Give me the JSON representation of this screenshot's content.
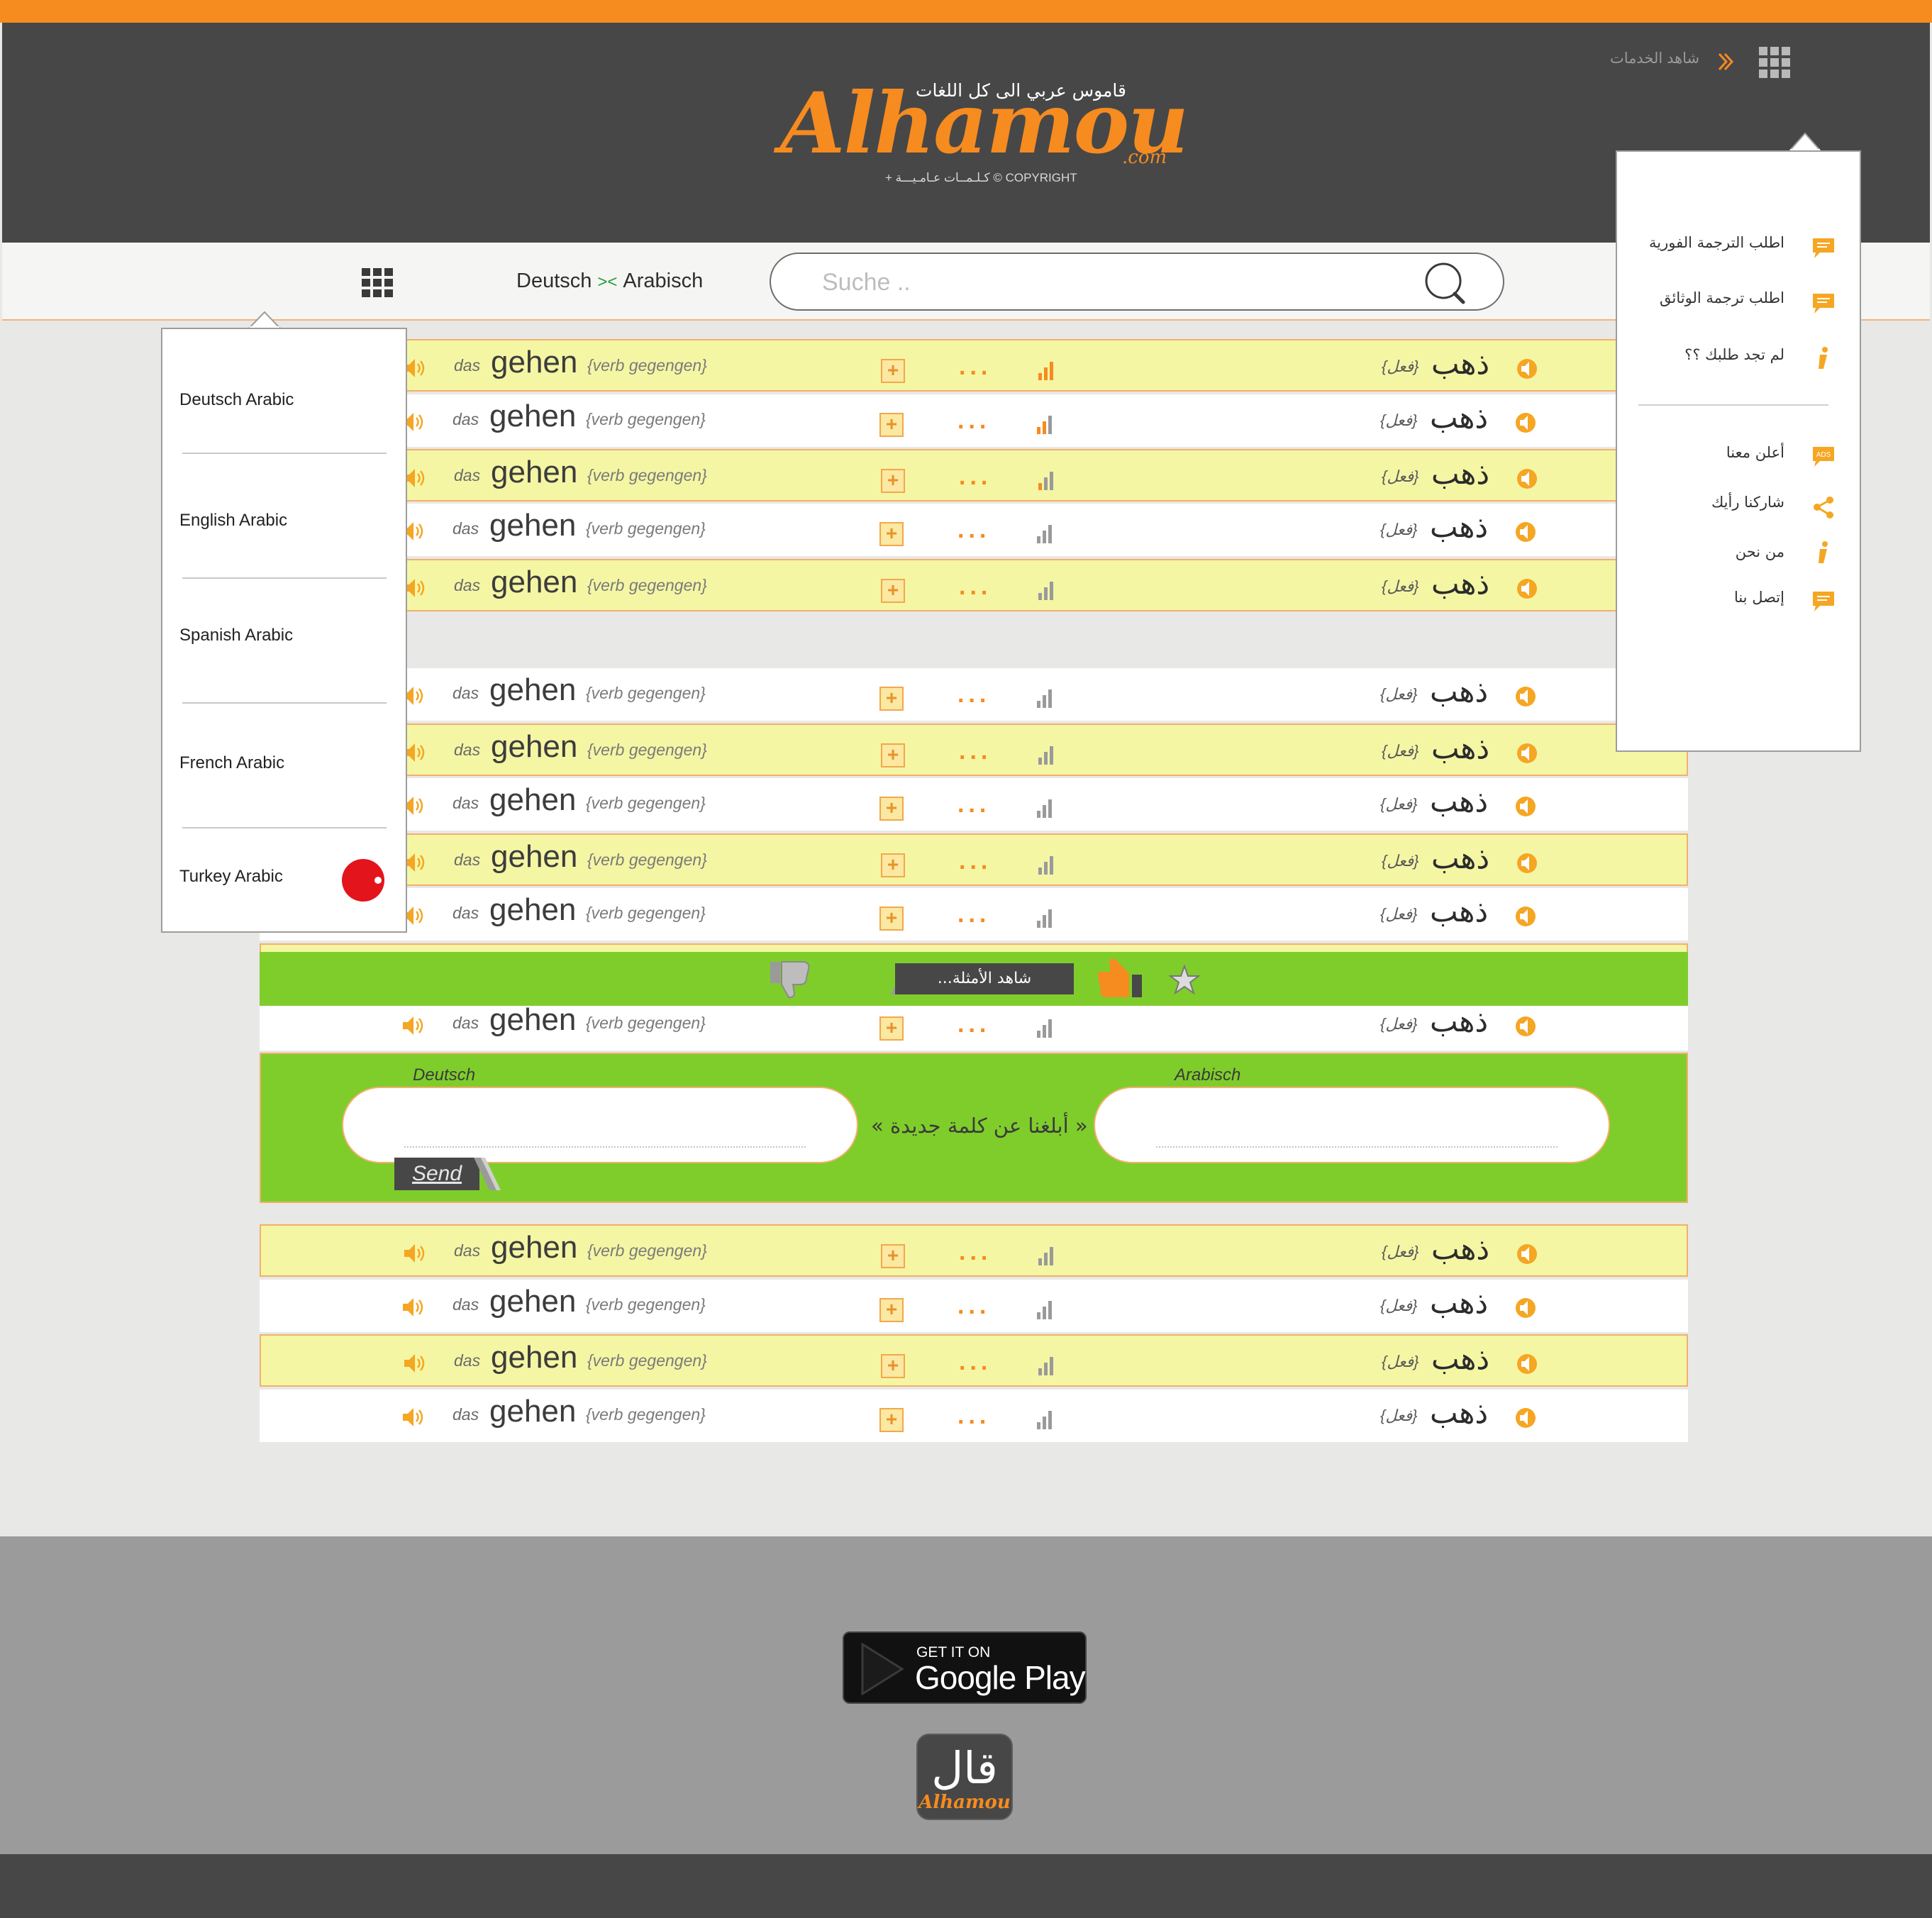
{
  "logo": {
    "tagline": "قاموس عربي الى كل اللغات",
    "wordmark": "Alhamou",
    "domain_suffix": ".com",
    "copyright": "+ كـلـمــات عـامـيـــة © COPYRIGHT"
  },
  "header": {
    "services_link": "شاهد الخدمات",
    "services_icon": "grid-icon",
    "accent_color": "#f68b1f",
    "header_color": "#474748"
  },
  "search": {
    "language_pair": {
      "from": "Deutsch",
      "arrow": "><",
      "to": "Arabisch"
    },
    "placeholder": "Suche .."
  },
  "entry": {
    "article": "das",
    "word": "gehen",
    "grammar": "{verb gegengen}",
    "plus": "+",
    "dots": "...",
    "arabic_word": "ذهب",
    "arabic_grammar": "{فعل}"
  },
  "rows": [
    {
      "style": "yellow",
      "rating": 3
    },
    {
      "style": "white",
      "rating": 2
    },
    {
      "style": "yellow",
      "rating": 1
    },
    {
      "style": "white",
      "rating": 0
    },
    {
      "style": "yellow",
      "rating": 0
    },
    {
      "style": "white",
      "rating": 0
    },
    {
      "style": "yellow",
      "rating": 0
    },
    {
      "style": "white",
      "rating": 0
    },
    {
      "style": "yellow",
      "rating": 0
    },
    {
      "style": "white",
      "rating": 0
    },
    {
      "style": "yellow",
      "rating": 0
    },
    {
      "style": "white",
      "rating": 0
    },
    {
      "style": "yellow",
      "rating": 0
    },
    {
      "style": "white",
      "rating": 0
    },
    {
      "style": "yellow",
      "rating": 0
    },
    {
      "style": "white",
      "rating": 0
    }
  ],
  "example_bar": {
    "button_label": "شاهد الأمثلة..."
  },
  "report": {
    "label_de": "Deutsch",
    "label_ar": "Arabisch",
    "title": "« أبلغنا عن كلمة جديدة »",
    "send_label": "Send"
  },
  "language_menu": {
    "items": [
      "Deutsch Arabic",
      "English Arabic",
      "Spanish Arabic",
      "French Arabic",
      "Turkey Arabic"
    ]
  },
  "service_menu": {
    "items": [
      {
        "label": "اطلب الترجمة الفورية",
        "icon": "chat-icon"
      },
      {
        "label": "اطلب ترجمة الوثائق",
        "icon": "chat-icon"
      },
      {
        "label": "لم تجد طلبك ؟؟",
        "icon": "info-icon"
      },
      {
        "label": "أعلن معنا",
        "icon": "ads-icon",
        "icon_text": "ADS"
      },
      {
        "label": "شاركنا رأيك",
        "icon": "share-icon"
      },
      {
        "label": "من نحن",
        "icon": "info-icon"
      },
      {
        "label": "إتصل بنا",
        "icon": "chat-icon"
      }
    ]
  },
  "footer": {
    "gplay_small": "GET IT ON",
    "gplay_big": "Google Play",
    "app_icon_ar": "قال",
    "app_icon_word": "Alhamou"
  }
}
